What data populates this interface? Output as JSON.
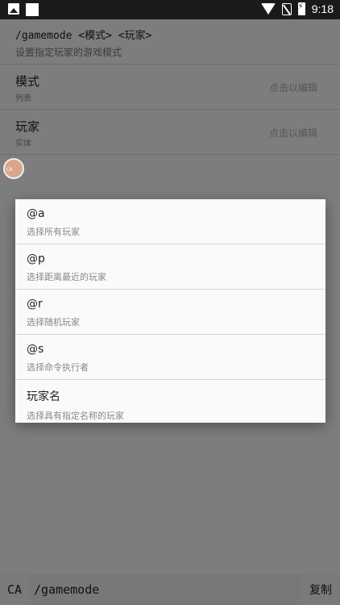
{
  "status_bar": {
    "time": "9:18",
    "icons": [
      "image-icon",
      "square-icon",
      "wifi-icon",
      "no-sim-icon",
      "battery-charging-icon"
    ]
  },
  "command": {
    "syntax": "/gamemode <模式> <玩家>",
    "description": "设置指定玩家的游戏模式"
  },
  "params": [
    {
      "name": "模式",
      "type": "列表",
      "action": "点击以编辑"
    },
    {
      "name": "玩家",
      "type": "实体",
      "action": "点击以编辑"
    }
  ],
  "floating_badge": {
    "text": "CA"
  },
  "dialog": {
    "options": [
      {
        "label": "@a",
        "desc": "选择所有玩家"
      },
      {
        "label": "@p",
        "desc": "选择距离最近的玩家"
      },
      {
        "label": "@r",
        "desc": "选择随机玩家"
      },
      {
        "label": "@s",
        "desc": "选择命令执行者"
      },
      {
        "label": "玩家名",
        "desc": "选择具有指定名称的玩家"
      }
    ]
  },
  "bottom_bar": {
    "ca_label": "CA",
    "input_value": "/gamemode",
    "copy_label": "复制"
  },
  "colors": {
    "background": "#fafafa",
    "status_bar": "#1a1a1a",
    "overlay": "rgba(0,0,0,0.5)"
  }
}
